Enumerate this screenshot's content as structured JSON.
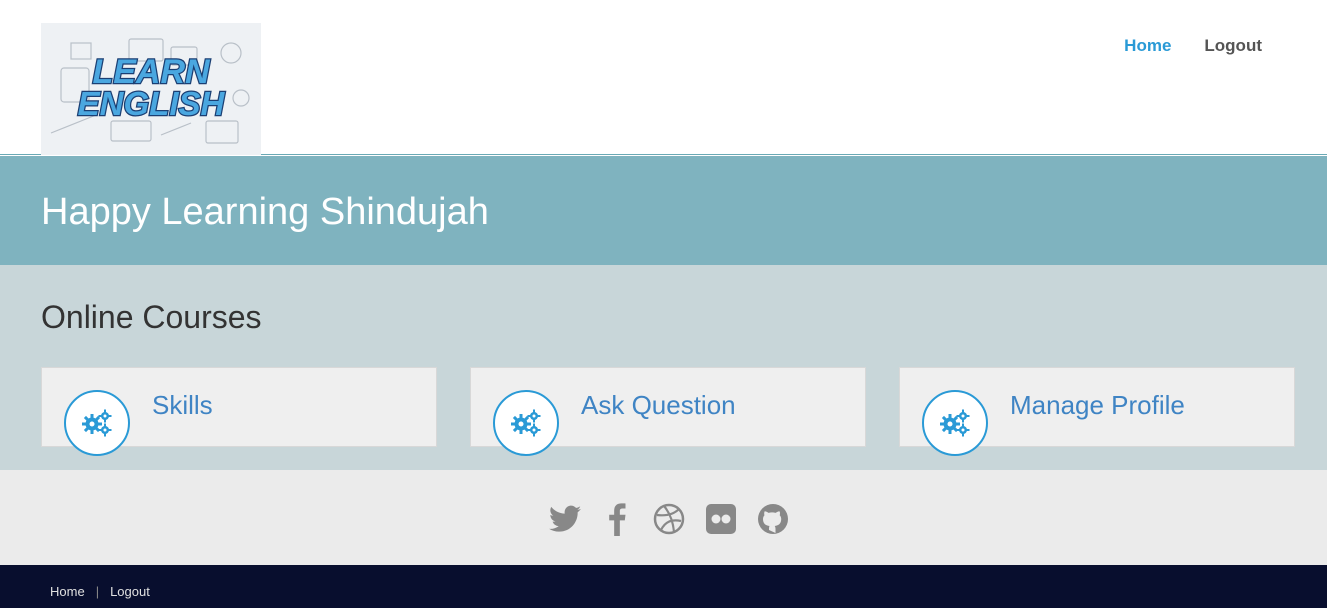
{
  "header": {
    "logo_text_line1": "LEARN",
    "logo_text_line2": "ENGLISH",
    "nav": {
      "home": "Home",
      "logout": "Logout"
    }
  },
  "banner": {
    "title": "Happy Learning Shindujah"
  },
  "courses": {
    "heading": "Online Courses",
    "cards": [
      {
        "label": "Skills",
        "icon": "gears-icon"
      },
      {
        "label": "Ask Question",
        "icon": "gears-icon"
      },
      {
        "label": "Manage Profile",
        "icon": "gears-icon"
      }
    ]
  },
  "social": [
    "twitter-icon",
    "facebook-icon",
    "dribbble-icon",
    "flickr-icon",
    "github-icon"
  ],
  "footer": {
    "home": "Home",
    "separator": "|",
    "logout": "Logout"
  },
  "colors": {
    "accent": "#2a9ad6",
    "banner": "#7fb3bf",
    "courses_bg": "#c8d6d9",
    "footer_bg": "#080e2e"
  }
}
